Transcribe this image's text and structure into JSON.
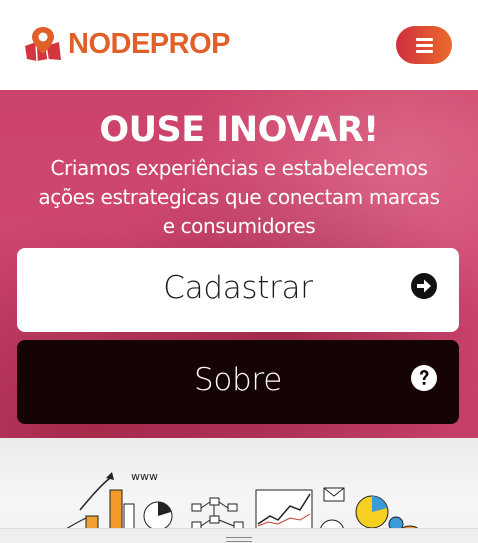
{
  "header": {
    "logo_text": "NODEPROP",
    "brand_color": "#e0602a",
    "menu_icon": "hamburger-icon"
  },
  "hero": {
    "title": "OUSE INOVAR!",
    "subtitle": "Criamos experiências e estabelecemos ações estrategicas que conectam marcas e consumidores"
  },
  "buttons": {
    "cadastrar_label": "Cadastrar",
    "cadastrar_icon": "arrow-right-circle-icon",
    "sobre_label": "Sobre",
    "sobre_icon": "question-circle-icon"
  },
  "illustration": {
    "www_text": "www"
  },
  "colors": {
    "accent_start": "#cf2f3f",
    "accent_end": "#ec6a2c",
    "sobre_bg": "#160404"
  }
}
